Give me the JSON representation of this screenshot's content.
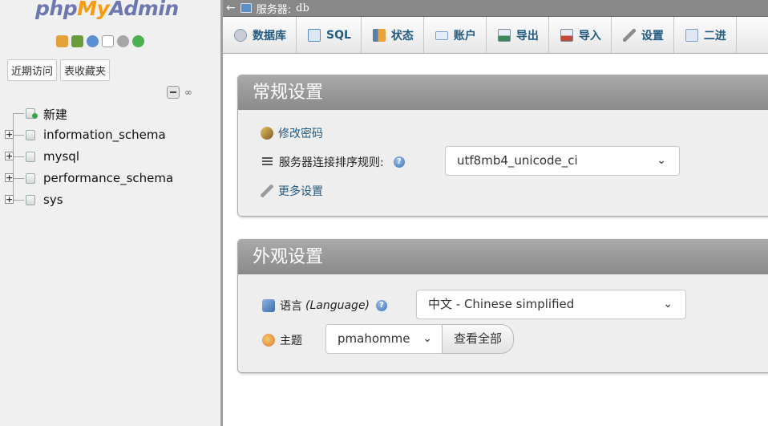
{
  "nav": {
    "logo_php": "php",
    "logo_my": "My",
    "logo_admin": "Admin",
    "icons": [
      "home-icon",
      "exit-icon",
      "help-icon",
      "docs-icon",
      "settings-icon",
      "reload-icon"
    ],
    "tabs": [
      "近期访问",
      "表收藏夹"
    ],
    "link_symbol": "⊖",
    "tree": [
      {
        "label": "新建",
        "expandable": false,
        "is_new": true
      },
      {
        "label": "information_schema",
        "expandable": true
      },
      {
        "label": "mysql",
        "expandable": true
      },
      {
        "label": "performance_schema",
        "expandable": true
      },
      {
        "label": "sys",
        "expandable": true
      }
    ],
    "expand_symbol": "+"
  },
  "breadcrumb": {
    "back": "←",
    "server_label": "服务器:",
    "server_name": "db"
  },
  "menu": [
    {
      "label": "数据库",
      "icon": "database-icon",
      "color": "#8a9bb0"
    },
    {
      "label": "SQL",
      "icon": "sql-icon",
      "color": "#5a8ac4"
    },
    {
      "label": "状态",
      "icon": "status-icon",
      "color": "#5a7ea8"
    },
    {
      "label": "账户",
      "icon": "accounts-icon",
      "color": "#7a9cc8"
    },
    {
      "label": "导出",
      "icon": "export-icon",
      "color": "#3c8a5a"
    },
    {
      "label": "导入",
      "icon": "import-icon",
      "color": "#c34b3b"
    },
    {
      "label": "设置",
      "icon": "wrench-icon",
      "color": "#8c8c8c"
    },
    {
      "label": "二进",
      "icon": "binlog-icon",
      "color": "#7da0c4"
    }
  ],
  "general": {
    "title": "常规设置",
    "change_password": "修改密码",
    "collation_label": "服务器连接排序规则:",
    "collation_value": "utf8mb4_unicode_ci",
    "more_settings": "更多设置"
  },
  "appearance": {
    "title": "外观设置",
    "language_label": "语言",
    "language_paren": "(Language)",
    "language_value": "中文 - Chinese simplified",
    "theme_label": "主题",
    "theme_value": "pmahomme",
    "view_all": "查看全部"
  },
  "chevron": "⌄",
  "help_glyph": "?"
}
